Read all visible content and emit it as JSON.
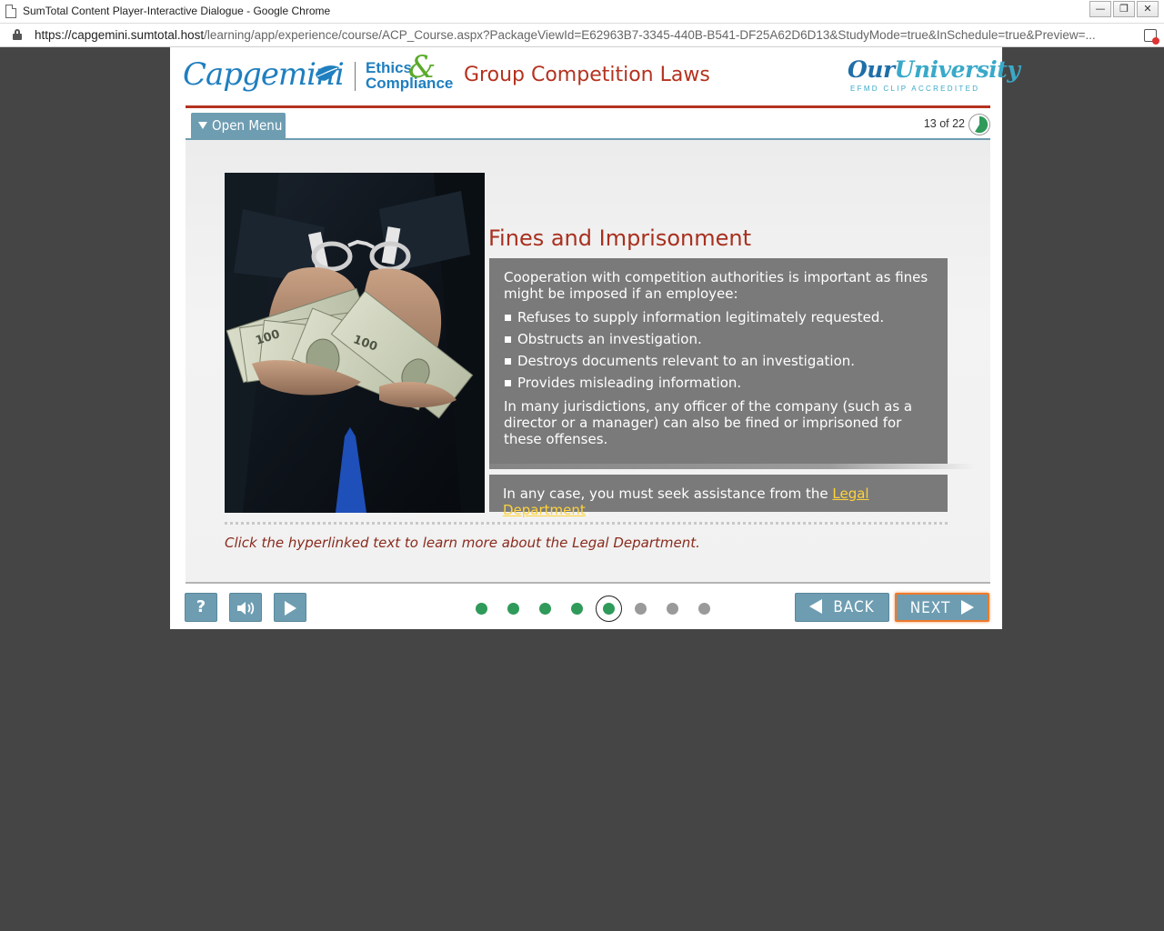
{
  "browser": {
    "window_title": "SumTotal Content Player-Interactive Dialogue - Google Chrome",
    "url_host": "https://capgemini.sumtotal.host",
    "url_path": "/learning/app/experience/course/ACP_Course.aspx?PackageViewId=E62963B7-3345-440B-B541-DF25A62D6D13&StudyMode=true&InSchedule=true&Preview=..."
  },
  "header": {
    "brand": "Capgemini",
    "ethics_line1": "Ethics",
    "ethics_line2": "Compliance",
    "ampersand": "&",
    "course_title": "Group Competition Laws",
    "university_prefix": "Our",
    "university_name": "University",
    "accreditation": "EFMD CLIP ACCREDITED"
  },
  "menu": {
    "open_menu_label": "Open Menu",
    "progress_text": "13 of 22",
    "progress_fraction": 0.59
  },
  "slide": {
    "heading": "Fines and Imprisonment",
    "intro": "Cooperation with competition authorities is important as fines might be imposed if an employee:",
    "bullets": [
      "Refuses to supply information legitimately requested.",
      "Obstructs an investigation.",
      "Destroys documents relevant to an investigation.",
      "Provides misleading information."
    ],
    "closing": "In many jurisdictions, any officer of the company (such as a director or a manager) can also be fined or imprisoned for these offenses.",
    "legal_prefix": "In any case, you must seek assistance from the ",
    "legal_link": "Legal Department",
    "legal_suffix": ".",
    "instruction": "Click the hyperlinked text to learn more about the Legal Department."
  },
  "footer": {
    "help_label": "?",
    "back_label": "BACK",
    "next_label": "NEXT",
    "page_dots": {
      "total": 8,
      "completed": 4,
      "current_index": 4
    }
  },
  "colors": {
    "accent_teal": "#6e9db2",
    "title_red": "#b5321f",
    "dot_green": "#2f9a5a",
    "link_yellow": "#ffd23a",
    "next_highlight": "#f07a2a"
  }
}
